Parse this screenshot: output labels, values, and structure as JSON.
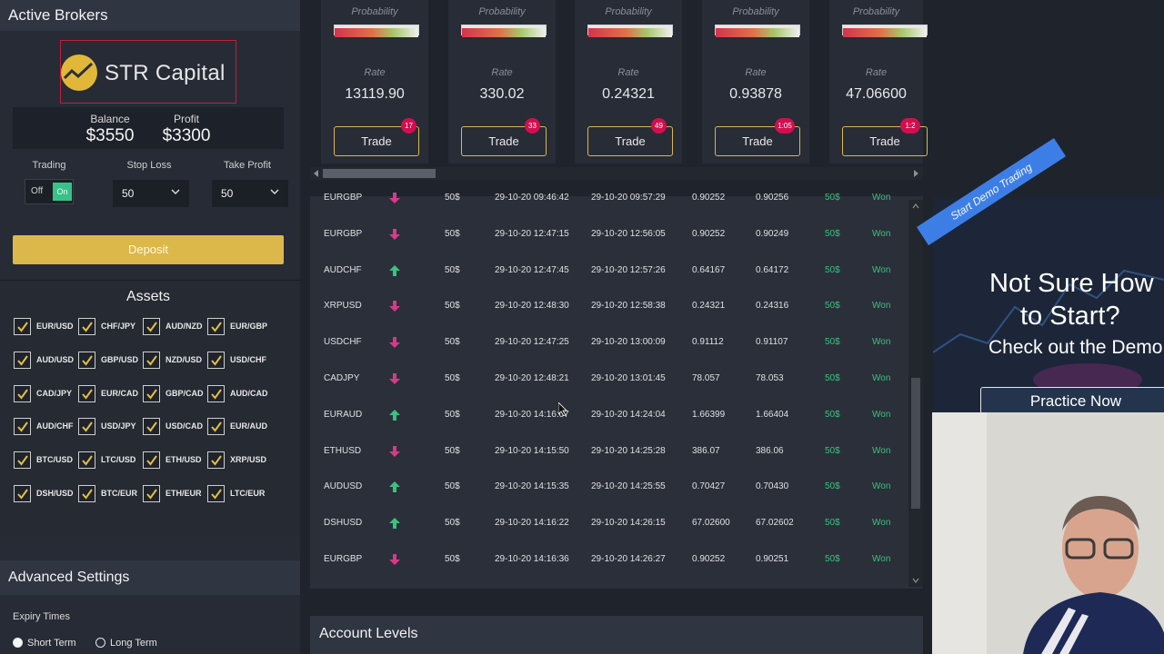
{
  "active_brokers": {
    "title": "Active Brokers",
    "broker_name": "STR Capital",
    "balance_label": "Balance",
    "balance_value": "$3550",
    "profit_label": "Profit",
    "profit_value": "$3300",
    "trading_label": "Trading",
    "toggle_off": "Off",
    "toggle_on": "On",
    "stop_loss_label": "Stop Loss",
    "stop_loss_value": "50",
    "take_profit_label": "Take Profit",
    "take_profit_value": "50",
    "deposit_label": "Deposit",
    "accent_color": "#dcb84a"
  },
  "assets": {
    "title": "Assets",
    "items": [
      "EUR/USD",
      "CHF/JPY",
      "AUD/NZD",
      "EUR/GBP",
      "AUD/USD",
      "GBP/USD",
      "NZD/USD",
      "USD/CHF",
      "CAD/JPY",
      "EUR/CAD",
      "GBP/CAD",
      "AUD/CAD",
      "AUD/CHF",
      "USD/JPY",
      "USD/CAD",
      "EUR/AUD",
      "BTC/USD",
      "LTC/USD",
      "ETH/USD",
      "XRP/USD",
      "DSH/USD",
      "BTC/EUR",
      "ETH/EUR",
      "LTC/EUR"
    ]
  },
  "advanced": {
    "title": "Advanced Settings",
    "expiry_label": "Expiry Times",
    "short_term": "Short Term",
    "long_term": "Long Term"
  },
  "cards": [
    {
      "prob": "Probability",
      "rate_label": "Rate",
      "rate": "13119.90",
      "trade": "Trade",
      "badge": "17"
    },
    {
      "prob": "Probability",
      "rate_label": "Rate",
      "rate": "330.02",
      "trade": "Trade",
      "badge": "33"
    },
    {
      "prob": "Probability",
      "rate_label": "Rate",
      "rate": "0.24321",
      "trade": "Trade",
      "badge": "49"
    },
    {
      "prob": "Probability",
      "rate_label": "Rate",
      "rate": "0.93878",
      "trade": "Trade",
      "badge": "1:05"
    },
    {
      "prob": "Probability",
      "rate_label": "Rate",
      "rate": "47.06600",
      "trade": "Trade",
      "badge": "1:2"
    }
  ],
  "trades": [
    {
      "pair": "EURGBP",
      "dir": "down",
      "amount": "50$",
      "open": "29-10-20 09:46:42",
      "close": "29-10-20 09:57:29",
      "open_rate": "0.90252",
      "close_rate": "0.90256",
      "payout": "50$",
      "result": "Won"
    },
    {
      "pair": "EURGBP",
      "dir": "down",
      "amount": "50$",
      "open": "29-10-20 12:47:15",
      "close": "29-10-20 12:56:05",
      "open_rate": "0.90252",
      "close_rate": "0.90249",
      "payout": "50$",
      "result": "Won"
    },
    {
      "pair": "AUDCHF",
      "dir": "up",
      "amount": "50$",
      "open": "29-10-20 12:47:45",
      "close": "29-10-20 12:57:26",
      "open_rate": "0.64167",
      "close_rate": "0.64172",
      "payout": "50$",
      "result": "Won"
    },
    {
      "pair": "XRPUSD",
      "dir": "down",
      "amount": "50$",
      "open": "29-10-20 12:48:30",
      "close": "29-10-20 12:58:38",
      "open_rate": "0.24321",
      "close_rate": "0.24316",
      "payout": "50$",
      "result": "Won"
    },
    {
      "pair": "USDCHF",
      "dir": "down",
      "amount": "50$",
      "open": "29-10-20 12:47:25",
      "close": "29-10-20 13:00:09",
      "open_rate": "0.91112",
      "close_rate": "0.91107",
      "payout": "50$",
      "result": "Won"
    },
    {
      "pair": "CADJPY",
      "dir": "down",
      "amount": "50$",
      "open": "29-10-20 12:48:21",
      "close": "29-10-20 13:01:45",
      "open_rate": "78.057",
      "close_rate": "78.053",
      "payout": "50$",
      "result": "Won"
    },
    {
      "pair": "EURAUD",
      "dir": "up",
      "amount": "50$",
      "open": "29-10-20 14:16:07",
      "close": "29-10-20 14:24:04",
      "open_rate": "1.66399",
      "close_rate": "1.66404",
      "payout": "50$",
      "result": "Won"
    },
    {
      "pair": "ETHUSD",
      "dir": "down",
      "amount": "50$",
      "open": "29-10-20 14:15:50",
      "close": "29-10-20 14:25:28",
      "open_rate": "386.07",
      "close_rate": "386.06",
      "payout": "50$",
      "result": "Won"
    },
    {
      "pair": "AUDUSD",
      "dir": "up",
      "amount": "50$",
      "open": "29-10-20 14:15:35",
      "close": "29-10-20 14:25:55",
      "open_rate": "0.70427",
      "close_rate": "0.70430",
      "payout": "50$",
      "result": "Won"
    },
    {
      "pair": "DSHUSD",
      "dir": "up",
      "amount": "50$",
      "open": "29-10-20 14:16:22",
      "close": "29-10-20 14:26:15",
      "open_rate": "67.02600",
      "close_rate": "67.02602",
      "payout": "50$",
      "result": "Won"
    },
    {
      "pair": "EURGBP",
      "dir": "down",
      "amount": "50$",
      "open": "29-10-20 14:16:36",
      "close": "29-10-20 14:26:27",
      "open_rate": "0.90252",
      "close_rate": "0.90251",
      "payout": "50$",
      "result": "Won"
    }
  ],
  "account_levels": {
    "title": "Account Levels"
  },
  "promo": {
    "ribbon": "Start Demo Trading",
    "line1": "Not Sure How",
    "line2": "to Start?",
    "line3": "Check out the Demo",
    "button": "Practice Now"
  },
  "colors": {
    "up_arrow": "#3bc27e",
    "down_arrow": "#d63a8a",
    "won": "#3bc27e",
    "badge": "#d10f4f"
  }
}
